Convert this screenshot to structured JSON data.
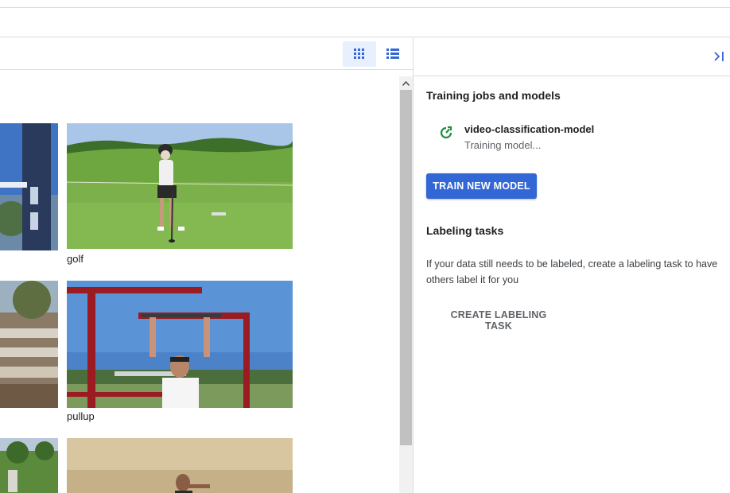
{
  "toolbar": {
    "grid_view_icon": "grid-icon",
    "list_view_icon": "list-icon",
    "collapse_icon": "collapse-right-icon"
  },
  "gallery": {
    "items": [
      {
        "label": "golf"
      },
      {
        "label": "pullup"
      },
      {
        "label": ""
      }
    ]
  },
  "panel": {
    "training_title": "Training jobs and models",
    "model": {
      "name": "video-classification-model",
      "status": "Training model...",
      "status_icon": "progress-icon",
      "status_color": "#1e8e3e"
    },
    "train_button": "TRAIN NEW MODEL",
    "labeling_title": "Labeling tasks",
    "labeling_desc": "If your data still needs to be labeled, create a labeling task to have others label it for you",
    "create_labeling_button": "CREATE LABELING TASK"
  },
  "colors": {
    "accent": "#3367d6",
    "active_bg": "#e8f0fe"
  }
}
